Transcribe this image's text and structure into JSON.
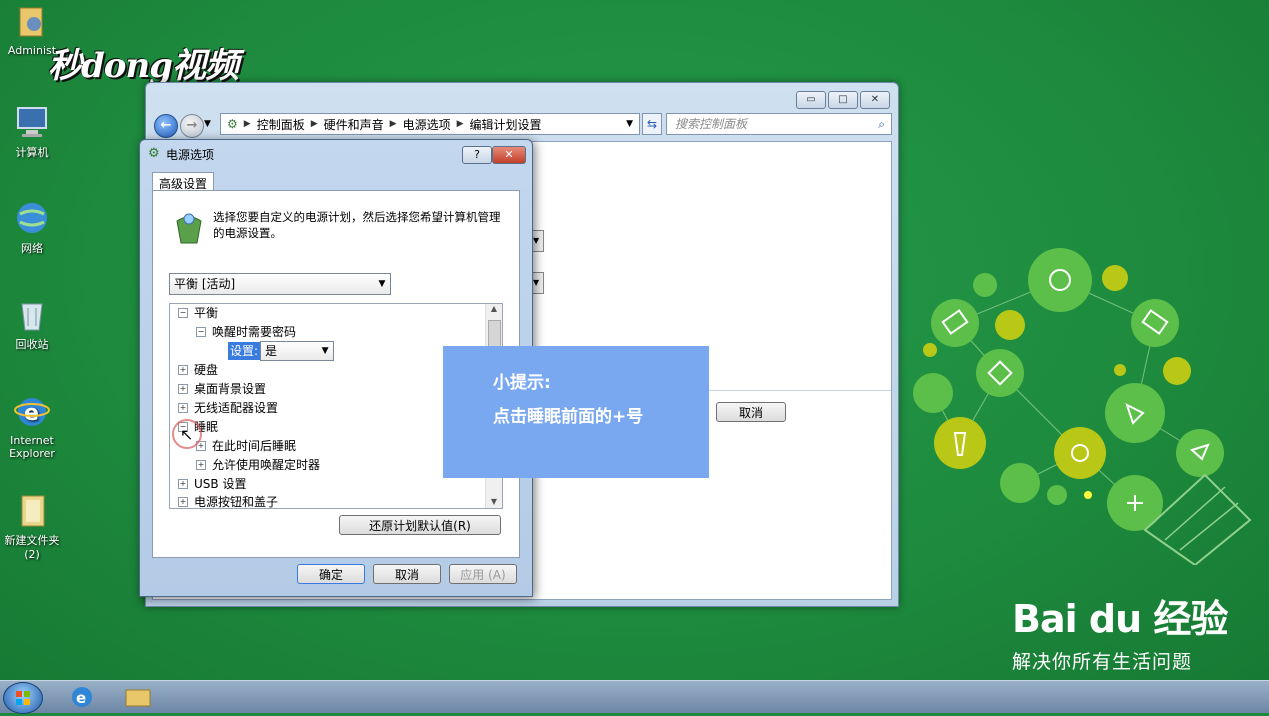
{
  "desktop": {
    "watermark": "秒dong视频",
    "icons": [
      {
        "label": "Administ",
        "icon": "user-folder-icon"
      },
      {
        "label": "计算机",
        "icon": "computer-icon"
      },
      {
        "label": "网络",
        "icon": "network-icon"
      },
      {
        "label": "回收站",
        "icon": "recycle-bin-icon"
      },
      {
        "label": "Internet Explorer",
        "icon": "ie-icon"
      },
      {
        "label": "新建文件夹 (2)",
        "icon": "folder-icon"
      }
    ]
  },
  "explorer": {
    "breadcrumb": [
      "控制面板",
      "硬件和声音",
      "电源选项",
      "编辑计划设置"
    ],
    "search_placeholder": "搜索控制面板",
    "cancel_label": "取消"
  },
  "dialog": {
    "title": "电源选项",
    "help_label": "?",
    "close_label": "✕",
    "tab": "高级设置",
    "description": "选择您要自定义的电源计划，然后选择您希望计算机管理的电源设置。",
    "plan_select": "平衡 [活动]",
    "tree": {
      "balance": "平衡",
      "wake_password": "唤醒时需要密码",
      "setting_label": "设置:",
      "setting_value": "是",
      "hard_disk": "硬盘",
      "desktop_bg": "桌面背景设置",
      "wireless": "无线适配器设置",
      "sleep": "睡眠",
      "sleep_after": "在此时间后睡眠",
      "wake_timers": "允许使用唤醒定时器",
      "usb": "USB 设置",
      "power_buttons": "电源按钮和盖子"
    },
    "restore_button": "还原计划默认值(R)",
    "ok_button": "确定",
    "cancel_button": "取消",
    "apply_button": "应用 (A)"
  },
  "tip": {
    "title": "小提示:",
    "text": "点击睡眠前面的+号"
  },
  "baidu": {
    "logo": "Bai du 经验",
    "slogan": "解决你所有生活问题"
  },
  "colors": {
    "desktop": "#1e8a3e",
    "tip_bg": "#7aa8f0",
    "selected": "#3a7be0"
  }
}
